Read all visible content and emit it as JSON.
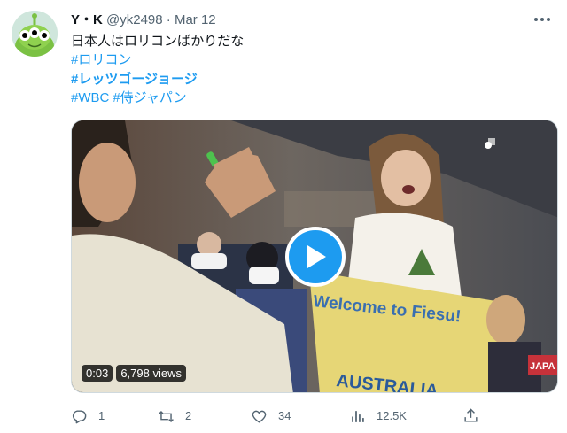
{
  "tweet": {
    "author_name": "Y・K",
    "author_handle": "@yk2498",
    "separator": "·",
    "date": "Mar 12",
    "text": "日本人はロリコンばかりだな",
    "hashtags_line1": "#ロリコン",
    "hashtags_line2": "#レッツゴージョージ",
    "hashtags_line3": [
      "#WBC",
      "#侍ジャパン"
    ]
  },
  "video": {
    "time": "0:03",
    "views": "6,798 views",
    "banner_text": "Welcome to Fiesu!",
    "banner_text_lower": "AUSTRALIA",
    "corner_sign": "JAPA"
  },
  "actions": {
    "replies": "1",
    "retweets": "2",
    "likes": "34",
    "views": "12.5K"
  },
  "colors": {
    "accent": "#1d9bf0",
    "text": "#0f1419",
    "muted": "#536471"
  },
  "icons": [
    "avatar-alien",
    "more-icon",
    "play-icon",
    "reply-icon",
    "retweet-icon",
    "like-icon",
    "views-icon",
    "share-icon"
  ]
}
